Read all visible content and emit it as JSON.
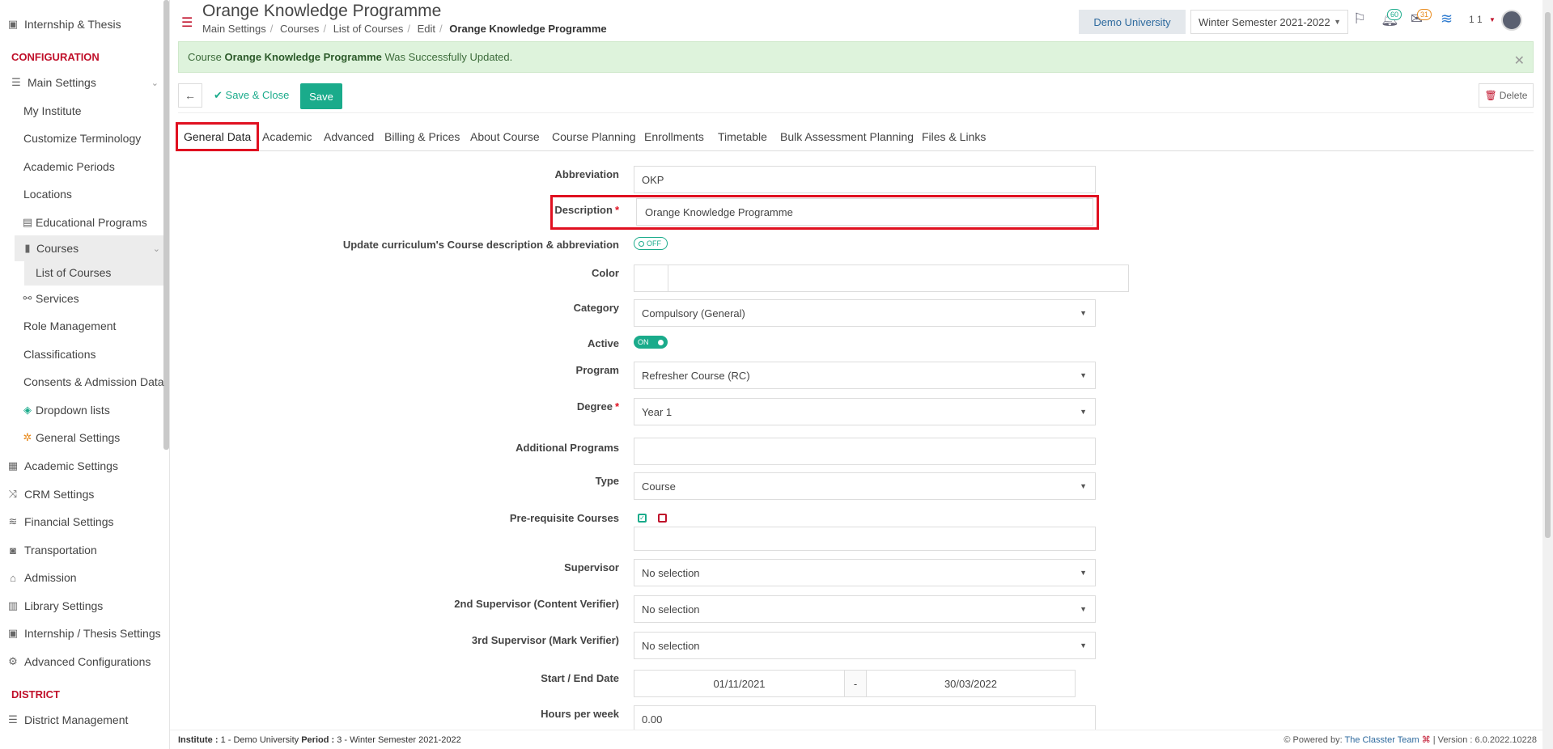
{
  "sidebar": {
    "top_item": "Internship & Thesis",
    "configuration_heading": "CONFIGURATION",
    "main_settings": "Main Settings",
    "main_items": [
      "My Institute",
      "Customize Terminology",
      "Academic Periods",
      "Locations"
    ],
    "educational_programs": "Educational Programs",
    "courses": "Courses",
    "list_of_courses": "List of Courses",
    "services": "Services",
    "more_items": [
      "Role Management",
      "Classifications",
      "Consents & Admission Data"
    ],
    "dropdown_lists": "Dropdown lists",
    "general_settings": "General Settings",
    "sections": [
      "Academic Settings",
      "CRM Settings",
      "Financial Settings",
      "Transportation",
      "Admission",
      "Library Settings",
      "Internship / Thesis Settings",
      "Advanced Configurations"
    ],
    "district_heading": "DISTRICT",
    "district_management": "District Management"
  },
  "header": {
    "title": "Orange Knowledge Programme",
    "breadcrumb": [
      "Main Settings",
      "Courses",
      "List of Courses",
      "Edit"
    ],
    "breadcrumb_current": "Orange Knowledge Programme",
    "university": "Demo University",
    "period": "Winter Semester 2021-2022",
    "notifications_count": "60",
    "messages_count": "31",
    "user_label": "1 1"
  },
  "alert": {
    "prefix": "Course",
    "course_name": "Orange Knowledge Programme",
    "suffix": "Was Successfully Updated."
  },
  "toolbar": {
    "save_close": "Save & Close",
    "save": "Save",
    "delete": "Delete"
  },
  "tabs": [
    "General Data",
    "Academic",
    "Advanced",
    "Billing & Prices",
    "About Course",
    "Course Planning",
    "Enrollments",
    "Timetable",
    "Bulk Assessment Planning",
    "Files & Links"
  ],
  "form": {
    "abbreviation_label": "Abbreviation",
    "abbreviation_value": "OKP",
    "description_label": "Description",
    "description_value": "Orange Knowledge Programme",
    "update_label": "Update curriculum's Course description & abbreviation",
    "update_toggle": "OFF",
    "color_label": "Color",
    "category_label": "Category",
    "category_value": "Compulsory (General)",
    "active_label": "Active",
    "active_toggle": "ON",
    "program_label": "Program",
    "program_value": "Refresher Course (RC)",
    "degree_label": "Degree",
    "degree_value": "Year 1",
    "additional_label": "Additional Programs",
    "type_label": "Type",
    "type_value": "Course",
    "prereq_label": "Pre-requisite Courses",
    "supervisor_label": "Supervisor",
    "supervisor_value": "No selection",
    "supervisor2_label": "2nd Supervisor (Content Verifier)",
    "supervisor2_value": "No selection",
    "supervisor3_label": "3rd Supervisor (Mark Verifier)",
    "supervisor3_value": "No selection",
    "dates_label": "Start / End Date",
    "start_date": "01/11/2021",
    "date_sep": "-",
    "end_date": "30/03/2022",
    "hours_label": "Hours per week",
    "hours_value": "0.00"
  },
  "footer": {
    "institute_label": "Institute :",
    "institute_value": "1 - Demo University",
    "period_label": "Period :",
    "period_value": "3 - Winter Semester 2021-2022",
    "powered_by": "Powered by:",
    "team": "The Classter Team",
    "version": "| Version : 6.0.2022.10228"
  },
  "colors": {
    "accent_green": "#1aab8b",
    "alert_red": "#e01020",
    "heading_red": "#c0102a"
  }
}
